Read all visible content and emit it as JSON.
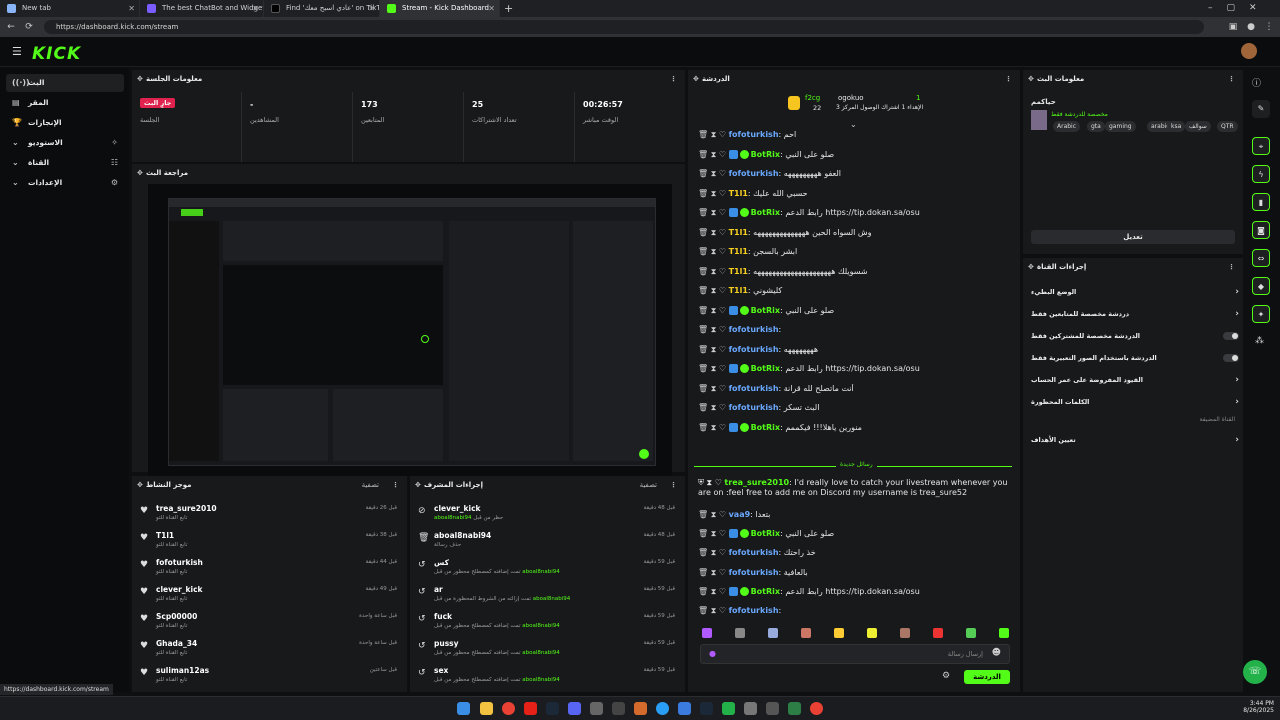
{
  "browser": {
    "tabs": [
      {
        "title": "New tab",
        "color": "#8ab4f8"
      },
      {
        "title": "The best ChatBot and Widgets fo",
        "color": "#7a5cff"
      },
      {
        "title": "Find 'عادي اسبح معك' on TikTok |",
        "color": "#111111"
      },
      {
        "title": "Stream - Kick Dashboard",
        "color": "#53fc18"
      }
    ],
    "url": "https://dashboard.kick.com/stream",
    "status_url": "https://dashboard.kick.com/stream"
  },
  "app": {
    "logo": "KICK",
    "brand_color": "#53fc18",
    "live_color": "#e0234e"
  },
  "sidebar": {
    "items": [
      {
        "label": "البث",
        "icon": "live-icon"
      },
      {
        "label": "المقر",
        "icon": "home-icon"
      },
      {
        "label": "الإنجازات",
        "icon": "trophy-icon"
      },
      {
        "label": "الاستوديو",
        "icon": "studio-icon"
      },
      {
        "label": "القناة",
        "icon": "channel-icon"
      },
      {
        "label": "الإعدادات",
        "icon": "gear-icon"
      }
    ]
  },
  "session": {
    "title": "معلومات الجلسة",
    "stats": [
      {
        "value": "جارٍ البث",
        "label": "الجلسة"
      },
      {
        "value": "-",
        "label": "المشاهدين"
      },
      {
        "value": "173",
        "label": "المتابعين"
      },
      {
        "value": "25",
        "label": "تعداد الاشتراكات"
      },
      {
        "value": "00:26:57",
        "label": "الوقت مباشر"
      }
    ]
  },
  "preview": {
    "title": "مراجعة البث"
  },
  "activity": {
    "title": "موجز النشاط",
    "filter": "تصفية",
    "items": [
      {
        "name": "trea_sure2010",
        "sub": "تابع القناة للتو",
        "time": "قبل 26 دقيقة"
      },
      {
        "name": "T1l1",
        "sub": "تابع القناة للتو",
        "time": "قبل 38 دقيقة"
      },
      {
        "name": "fofoturkish",
        "sub": "تابع القناة للتو",
        "time": "قبل 44 دقيقة"
      },
      {
        "name": "clever_kick",
        "sub": "تابع القناة للتو",
        "time": "قبل 49 دقيقة"
      },
      {
        "name": "Scp00000",
        "sub": "تابع القناة للتو",
        "time": "قبل ساعة واحدة"
      },
      {
        "name": "Ghada_34",
        "sub": "تابع القناة للتو",
        "time": "قبل ساعة واحدة"
      },
      {
        "name": "suliman12as",
        "sub": "تابع القناة للتو",
        "time": "قبل ساعتين"
      }
    ]
  },
  "modlog": {
    "title": "إجراءات المشرف",
    "filter": "تصفية",
    "items": [
      {
        "name": "clever_kick",
        "by": "aboal8nabi94",
        "sub": "حظر من قبل",
        "time": "قبل 48 دقيقة"
      },
      {
        "name": "aboal8nabi94",
        "by": "",
        "sub": "حذف رسالة",
        "time": "قبل 48 دقيقة"
      },
      {
        "name": "كس",
        "by": "aboal8nabi94",
        "sub": "تمت إضافته كمصطلح محظور من قبل",
        "time": "قبل 59 دقيقة"
      },
      {
        "name": "ar",
        "by": "aboal8nabi94",
        "sub": "تمت إزالته من الشروط المحظورة من قبل",
        "time": "قبل 59 دقيقة"
      },
      {
        "name": "fuck",
        "by": "aboal8nabi94",
        "sub": "تمت إضافته كمصطلح محظور من قبل",
        "time": "قبل 59 دقيقة"
      },
      {
        "name": "pussy",
        "by": "aboal8nabi94",
        "sub": "تمت إضافته كمصطلح محظور من قبل",
        "time": "قبل 59 دقيقة"
      },
      {
        "name": "sex",
        "by": "aboal8nabi94",
        "sub": "تمت إضافته كمصطلح محظور من قبل",
        "time": "قبل 59 دقيقة"
      }
    ]
  },
  "chat": {
    "title": "الدردشة",
    "pinned": {
      "user1": "f2cg",
      "count1": "22",
      "user2": "ogokuo",
      "count2": "1",
      "note": "الإهداء 1 اشتراك الوصول المركز 3"
    },
    "new_messages": "رسائل جديدة",
    "lines": [
      {
        "user": "fofoturkish",
        "color": "u-blue",
        "msg": "احم"
      },
      {
        "user": "BotRix",
        "color": "u-green",
        "msg": "صلو على النبي"
      },
      {
        "user": "fofoturkish",
        "color": "u-blue",
        "msg": "العفو هههههههههه"
      },
      {
        "user": "T1l1",
        "color": "u-yellow",
        "msg": "حسبي الله عليك"
      },
      {
        "user": "BotRix",
        "color": "u-green",
        "msg": "رابط الدعم https://tip.dokan.sa/osu"
      },
      {
        "user": "T1l1",
        "color": "u-yellow",
        "msg": "وش السواه الحين ههههههههههههههه"
      },
      {
        "user": "T1l1",
        "color": "u-yellow",
        "msg": "ابشر بالسجن"
      },
      {
        "user": "T1l1",
        "color": "u-yellow",
        "msg": "شسويلك هههههههههههههههههههههه"
      },
      {
        "user": "T1l1",
        "color": "u-yellow",
        "msg": "كليشوني"
      },
      {
        "user": "BotRix",
        "color": "u-green",
        "msg": "صلو على النبي"
      },
      {
        "user": "fofoturkish",
        "color": "u-blue",
        "msg": ""
      },
      {
        "user": "fofoturkish",
        "color": "u-blue",
        "msg": "ههههههههه"
      },
      {
        "user": "BotRix",
        "color": "u-green",
        "msg": "رابط الدعم https://tip.dokan.sa/osu"
      },
      {
        "user": "fofoturkish",
        "color": "u-blue",
        "msg": "أنت ماتصلح لله قرانة"
      },
      {
        "user": "fofoturkish",
        "color": "u-blue",
        "msg": "البث تسكر"
      },
      {
        "user": "BotRix",
        "color": "u-green",
        "msg": "منورين ياهلا!!! فيكممم"
      }
    ],
    "featured": {
      "user": "trea_sure2010",
      "msg": "I'd really love to catch your livestream whenever you are on :feel free to add me on Discord my username is trea_sure52"
    },
    "lines2": [
      {
        "user": "vaa9",
        "color": "u-blue",
        "msg": "بتعدا"
      },
      {
        "user": "BotRix",
        "color": "u-green",
        "msg": "صلو على النبي"
      },
      {
        "user": "fofoturkish",
        "color": "u-blue",
        "msg": "خذ راحتك"
      },
      {
        "user": "fofoturkish",
        "color": "u-blue",
        "msg": "بالعافية"
      },
      {
        "user": "BotRix",
        "color": "u-green",
        "msg": "رابط الدعم https://tip.dokan.sa/osu"
      },
      {
        "user": "fofoturkish",
        "color": "u-blue",
        "msg": ""
      }
    ],
    "placeholder": "إرسال رسالة",
    "send_label": "الدردشة"
  },
  "stream_info": {
    "title": "معلومات البث",
    "stream_title": "حياكمم",
    "category": "مخصصة للدردشة فقط",
    "tags": [
      "Arabic",
      "gta",
      "gaming",
      "arabic",
      "ksa",
      "سوالف",
      "QTR"
    ],
    "edit_label": "تعديل"
  },
  "channel_actions": {
    "title": "إجراءات القناة",
    "rows": [
      {
        "label": "الوضع البطيء",
        "type": "chevron"
      },
      {
        "label": "دردشة مخصصة للمتابعين فقط",
        "type": "chevron"
      },
      {
        "label": "الدردشة مخصصة للمشتركين فقط",
        "type": "toggle"
      },
      {
        "label": "الدردشة باستخدام الصور التعبيرية فقط",
        "type": "toggle"
      },
      {
        "label": "القيود المفروضة على عمر الحساب",
        "type": "chevron"
      },
      {
        "label": "الكلمات المحظورة",
        "type": "chevron"
      }
    ],
    "subheading": "القناة المضيفة",
    "host_row": "تعيين الأهداف"
  },
  "taskbar": {
    "time": "3:44 PM",
    "date": "8/26/2025"
  }
}
